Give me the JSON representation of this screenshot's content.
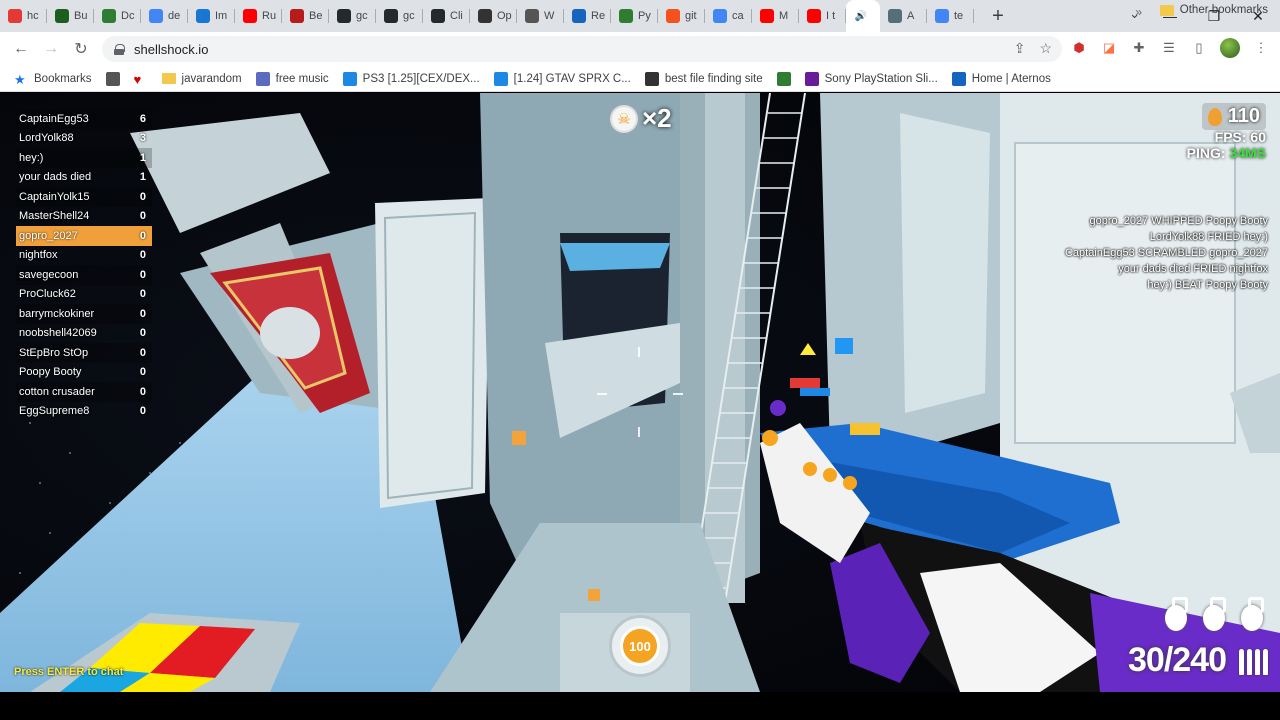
{
  "browser": {
    "tabs": [
      {
        "label": "hc",
        "color": "#e53935"
      },
      {
        "label": "Bu",
        "color": "#1b5e20"
      },
      {
        "label": "Dc",
        "color": "#2e7d32"
      },
      {
        "label": "de",
        "color": "#4285f4"
      },
      {
        "label": "Im",
        "color": "#1976d2"
      },
      {
        "label": "Ru",
        "color": "#ff0000"
      },
      {
        "label": "Be",
        "color": "#b71c1c"
      },
      {
        "label": "gc",
        "color": "#24292e"
      },
      {
        "label": "gc",
        "color": "#24292e"
      },
      {
        "label": "Cli",
        "color": "#24292e"
      },
      {
        "label": "Op",
        "color": "#333333"
      },
      {
        "label": "W",
        "color": "#555555"
      },
      {
        "label": "Re",
        "color": "#1565c0"
      },
      {
        "label": "Py",
        "color": "#2e7d32"
      },
      {
        "label": "git",
        "color": "#f4511e"
      },
      {
        "label": "ca",
        "color": "#4285f4"
      },
      {
        "label": "M",
        "color": "#ff0000"
      },
      {
        "label": "I t",
        "color": "#ff0000"
      },
      {
        "label": "",
        "color": "#000000"
      },
      {
        "label": "A",
        "color": "#546e7a"
      },
      {
        "label": "te",
        "color": "#4285f4"
      }
    ],
    "active_tab_index": 18,
    "url": "shellshock.io"
  },
  "bookmarks": {
    "items": [
      {
        "label": "Bookmarks",
        "icon": "star-icon",
        "color": "#1a73e8"
      },
      {
        "label": "",
        "icon": "globe-icon",
        "color": "#555555"
      },
      {
        "label": "",
        "icon": "heart-icon",
        "color": "#d50000"
      },
      {
        "label": "javarandom",
        "icon": "folder-icon",
        "color": "#f2c94c"
      },
      {
        "label": "free music",
        "icon": "music-icon",
        "color": "#5c6bc0"
      },
      {
        "label": "PS3 [1.25][CEX/DEX...",
        "icon": "c-icon",
        "color": "#1e88e5"
      },
      {
        "label": "[1.24] GTAV SPRX C...",
        "icon": "c-icon",
        "color": "#1e88e5"
      },
      {
        "label": "best file finding site",
        "icon": "site-icon",
        "color": "#333333"
      },
      {
        "label": "",
        "icon": "app-icon",
        "color": "#2e7d32"
      },
      {
        "label": "Sony PlayStation Sli...",
        "icon": "bag-icon",
        "color": "#6a1b9a"
      },
      {
        "label": "Home | Aternos",
        "icon": "aternos-icon",
        "color": "#1565c0"
      }
    ],
    "more": "»",
    "other": "Other bookmarks"
  },
  "game": {
    "scoreboard": [
      {
        "name": "CaptainEgg53",
        "score": "6"
      },
      {
        "name": "LordYolk88",
        "score": "3"
      },
      {
        "name": "hey:)",
        "score": "1"
      },
      {
        "name": "your dads died",
        "score": "1"
      },
      {
        "name": "CaptainYolk15",
        "score": "0"
      },
      {
        "name": "MasterShell24",
        "score": "0"
      },
      {
        "name": "gopro_2027",
        "score": "0"
      },
      {
        "name": "nightfox",
        "score": "0"
      },
      {
        "name": "savegecoon",
        "score": "0"
      },
      {
        "name": "ProCluck62",
        "score": "0"
      },
      {
        "name": "barrymckokiner",
        "score": "0"
      },
      {
        "name": "noobshell42069",
        "score": "0"
      },
      {
        "name": "StEpBro StOp",
        "score": "0"
      },
      {
        "name": "Poopy Booty",
        "score": "0"
      },
      {
        "name": "cotton crusader",
        "score": "0"
      },
      {
        "name": "EggSupreme8",
        "score": "0"
      }
    ],
    "my_player_index": 6,
    "kill_streak": "×2",
    "eggs": "110",
    "fps": "FPS: 60",
    "ping_label": "PING: ",
    "ping_value": "34MS",
    "killfeed": [
      "gopro_2027 WHIPPED Poopy Booty",
      "LordYolk88 FRIED hey:)",
      "CaptainEgg53 SCRAMBLED gopro_2027",
      "your dads died FRIED nightfox",
      "hey:) BEAT Poopy Booty"
    ],
    "health": "100",
    "ammo": "30/240",
    "grenades": 3,
    "chat_hint": "Press ENTER to chat"
  }
}
